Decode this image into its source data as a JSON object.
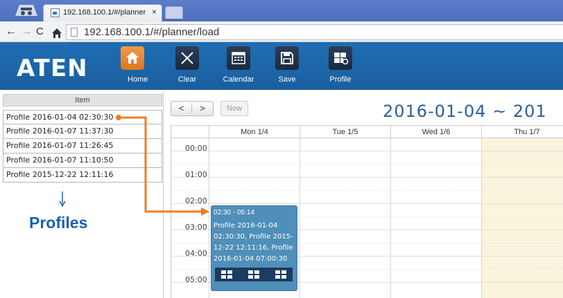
{
  "browser": {
    "tab_title": "192.168.100.1/#/planner",
    "tab_close": "×",
    "url": "192.168.100.1/#/planner/load"
  },
  "toolbar": {
    "logo": "ATEN",
    "buttons": [
      {
        "label": "Home",
        "icon": "home-icon"
      },
      {
        "label": "Clear",
        "icon": "close-icon"
      },
      {
        "label": "Calendar",
        "icon": "calendar-icon"
      },
      {
        "label": "Save",
        "icon": "save-icon"
      },
      {
        "label": "Profile",
        "icon": "profile-icon"
      }
    ]
  },
  "left_panel": {
    "header": "Item",
    "profiles": [
      "Profile 2016-01-04 02:30:30",
      "Profile 2016-01-07 11:37:30",
      "Profile 2016-01-07 11:26:45",
      "Profile 2016-01-07 11:10:50",
      "Profile 2015-12-22 12:11:16"
    ],
    "annotation": "Profiles",
    "annotation_arrow": "↓"
  },
  "calendar": {
    "prev": "<",
    "next": ">",
    "now": "Now",
    "range": "2016-01-04 ~ 201",
    "days": [
      "Mon 1/4",
      "Tue 1/5",
      "Wed 1/6",
      "Thu 1/7"
    ],
    "times": [
      "00:00",
      "01:00",
      "02:00",
      "03:00",
      "04:00",
      "05:00"
    ],
    "event": {
      "time": "02:30 - 05:14",
      "text": "Profile 2016-01-04 02:30:30, Profile 2015-12-22 12:11:16, Profile 2016-01-04 07:00:30"
    }
  },
  "colors": {
    "toolbar_blue": "#1f6db3",
    "home_orange": "#e07520",
    "event_blue": "#4f8fb9",
    "annotation_orange": "#ef7b22",
    "annotation_blue": "#1a5fb4",
    "today_bg": "#fbf4dc"
  }
}
